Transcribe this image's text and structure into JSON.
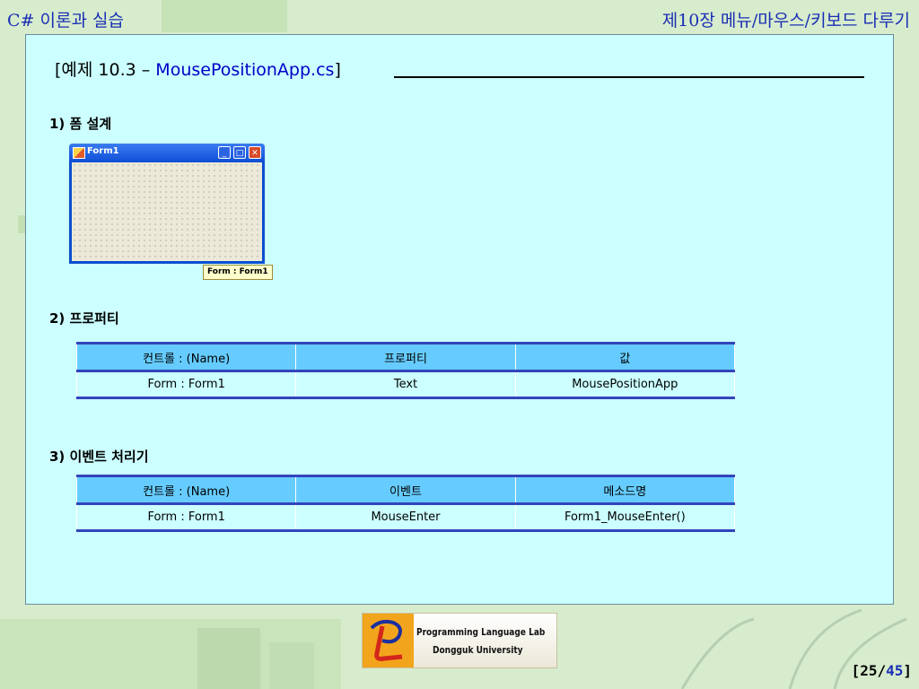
{
  "header": {
    "left_title": "C# 이론과 실습",
    "right_title": "제10장 메뉴/마우스/키보드 다루기"
  },
  "example": {
    "prefix": "[예제 10.3 – ",
    "filename": "MousePositionApp.cs",
    "suffix": "]"
  },
  "sections": {
    "s1": "1) 폼 설계",
    "s2": "2) 프로퍼티",
    "s3": "3) 이벤트 처리기"
  },
  "form_preview": {
    "title": "Form1",
    "tag": "Form : Form1"
  },
  "property_table": {
    "headers": [
      "컨트롤 : (Name)",
      "프로퍼티",
      "값"
    ],
    "rows": [
      [
        "Form : Form1",
        "Text",
        "MousePositionApp"
      ]
    ]
  },
  "event_table": {
    "headers": [
      "컨트롤 : (Name)",
      "이벤트",
      "메소드명"
    ],
    "rows": [
      [
        "Form : Form1",
        "MouseEnter",
        "Form1_MouseEnter()"
      ]
    ]
  },
  "logo": {
    "line1": "Programming Language Lab",
    "line2": "Dongguk University"
  },
  "page": {
    "current": "25",
    "total": "45"
  },
  "colors": {
    "panel_bg": "#ccffff",
    "table_header": "#66ccff",
    "table_rule": "#3344bb",
    "accent_blue": "#1a2fb5"
  }
}
